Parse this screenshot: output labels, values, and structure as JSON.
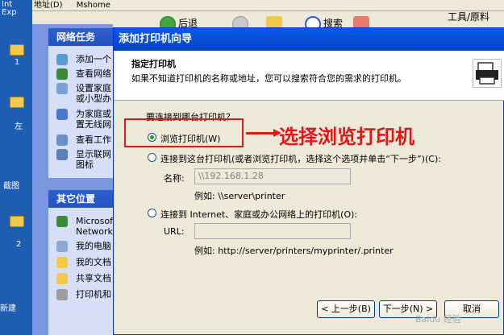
{
  "desktop": {
    "labels": [
      "Int",
      "Exp",
      "1",
      "左",
      "截图",
      "2",
      "新建"
    ]
  },
  "explorer": {
    "address_fragment": "地址(D)",
    "address_value": "Mshome",
    "back_label": "后退",
    "search_label": "搜索",
    "menu_right": "工具/原料"
  },
  "taskpane": {
    "network_tasks": {
      "header": "网络任务",
      "items": [
        "添加一个",
        "查看网络",
        "设置家庭",
        "或小型办",
        "为家庭或",
        "置无线网",
        "查看工作",
        "显示联网",
        "图标"
      ]
    },
    "other_places": {
      "header": "其它位置",
      "items": [
        "Microsoft",
        "Network",
        "我的电脑",
        "我的文档",
        "共享文档",
        "打印机和"
      ]
    }
  },
  "wizard": {
    "title": "添加打印机向导",
    "banner_title": "指定打印机",
    "banner_subtitle": "如果不知道打印机的名称或地址，您可以搜索符合您的需求的打印机。",
    "question": "要连接到哪台打印机？",
    "option1": "浏览打印机(W)",
    "option2": "连接到这台打印机(或者浏览打印机，选择这个选项并单击“下一步”)(C):",
    "name_label": "名称:",
    "name_value": "\\\\192.168.1.28",
    "name_example": "例如: \\\\server\\printer",
    "option3": "连接到 Internet、家庭或办公网络上的打印机(O):",
    "url_label": "URL:",
    "url_value": "",
    "url_example": "例如: http://server/printers/myprinter/.printer",
    "annotation": "选择浏览打印机",
    "back_button": "< 上一步(B)",
    "next_button": "下一步(N) >",
    "cancel_button": "取消"
  },
  "watermark": "Baidu 经验",
  "colors": {
    "title_bar": "#0a58e8",
    "annotation_red": "#e21818",
    "dialog_bg": "#ece9d8"
  }
}
